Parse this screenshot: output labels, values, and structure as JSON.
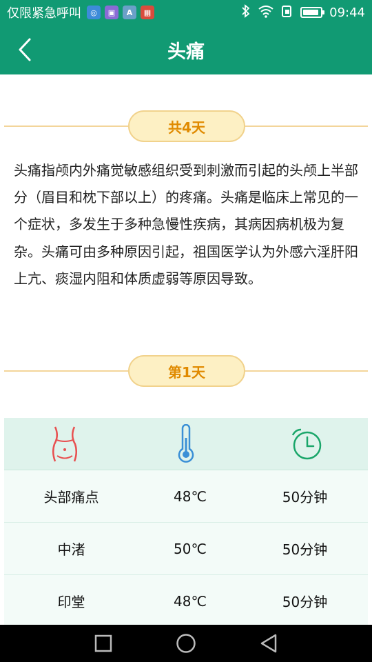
{
  "status_bar": {
    "carrier": "仅限紧急呼叫",
    "app_icons": [
      {
        "name": "browser-app-icon",
        "color": "#3d8bd9",
        "glyph": "◎"
      },
      {
        "name": "gallery-app-icon",
        "color": "#8a6bd6",
        "glyph": "▣"
      },
      {
        "name": "font-app-icon",
        "color": "#6aa0c8",
        "glyph": "A"
      },
      {
        "name": "calendar-app-icon",
        "color": "#d94c3d",
        "glyph": "▦"
      }
    ],
    "time": "09:44",
    "battery_level": 0.9
  },
  "header": {
    "title": "头痛",
    "background": "#119a73"
  },
  "summary_pill": "共4天",
  "description": "头痛指颅内外痛觉敏感组织受到刺激而引起的头颅上半部分（眉目和枕下部以上）的疼痛。头痛是临床上常见的一个症状，多发生于多种急慢性疾病，其病因病机极为复杂。头痛可由多种原因引起，祖国医学认为外感六淫肝阳上亢、痰湿内阻和体质虚弱等原因导致。",
  "day_pill": "第1天",
  "table": {
    "header_icons": [
      "waist-icon",
      "thermometer-icon",
      "alarm-clock-icon"
    ],
    "rows": [
      {
        "point": "头部痛点",
        "temp": "48℃",
        "duration": "50分钟"
      },
      {
        "point": "中渚",
        "temp": "50℃",
        "duration": "50分钟"
      },
      {
        "point": "印堂",
        "temp": "48℃",
        "duration": "50分钟"
      }
    ]
  },
  "colors": {
    "accent": "#119a73",
    "pill_text": "#e08a00",
    "pill_bg": "#fdf0c4",
    "table_header_bg": "#dff3ec",
    "icon_red": "#e85050",
    "icon_blue": "#3a8fd6",
    "icon_green": "#1aa66a"
  }
}
